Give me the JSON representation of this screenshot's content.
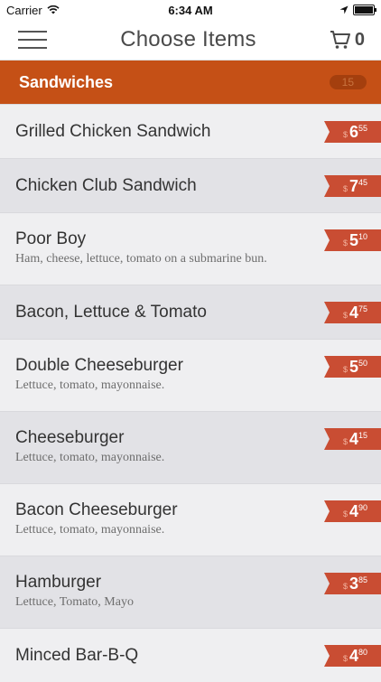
{
  "status": {
    "carrier": "Carrier",
    "time": "6:34 AM"
  },
  "nav": {
    "title": "Choose Items",
    "cart_count": "0"
  },
  "section": {
    "label": "Sandwiches",
    "count": "15"
  },
  "items": [
    {
      "name": "Grilled Chicken Sandwich",
      "desc": "",
      "currency": "$",
      "whole": "6",
      "cents": "55"
    },
    {
      "name": "Chicken Club Sandwich",
      "desc": "",
      "currency": "$",
      "whole": "7",
      "cents": "45"
    },
    {
      "name": "Poor Boy",
      "desc": "Ham, cheese, lettuce, tomato on a submarine bun.",
      "currency": "$",
      "whole": "5",
      "cents": "10"
    },
    {
      "name": "Bacon, Lettuce & Tomato",
      "desc": "",
      "currency": "$",
      "whole": "4",
      "cents": "75"
    },
    {
      "name": "Double Cheeseburger",
      "desc": "Lettuce, tomato, mayonnaise.",
      "currency": "$",
      "whole": "5",
      "cents": "50"
    },
    {
      "name": "Cheeseburger",
      "desc": "Lettuce, tomato, mayonnaise.",
      "currency": "$",
      "whole": "4",
      "cents": "15"
    },
    {
      "name": "Bacon Cheeseburger",
      "desc": "Lettuce, tomato, mayonnaise.",
      "currency": "$",
      "whole": "4",
      "cents": "90"
    },
    {
      "name": "Hamburger",
      "desc": "Lettuce, Tomato, Mayo",
      "currency": "$",
      "whole": "3",
      "cents": "85"
    },
    {
      "name": "Minced Bar-B-Q",
      "desc": "",
      "currency": "$",
      "whole": "4",
      "cents": "80"
    }
  ]
}
